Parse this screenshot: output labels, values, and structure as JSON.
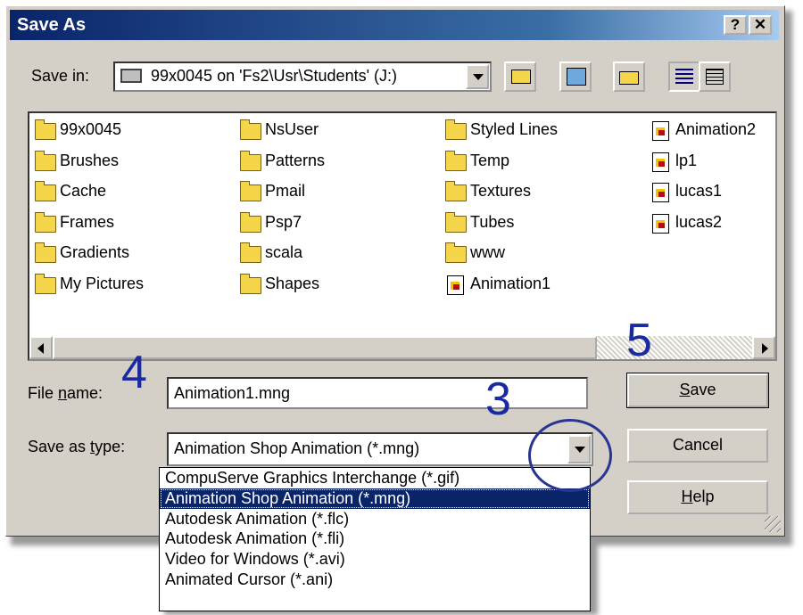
{
  "window": {
    "title": "Save As",
    "help_btn": "?",
    "close_btn": "✕"
  },
  "toolbar": {
    "save_in_label": "Save in:",
    "save_in_value": "99x0045 on 'Fs2\\Usr\\Students' (J:)",
    "tools": [
      "up-folder-icon",
      "desktop-icon",
      "new-folder-icon",
      "list-view-icon",
      "details-view-icon"
    ]
  },
  "files": {
    "columns": [
      [
        {
          "name": "99x0045",
          "type": "folder"
        },
        {
          "name": "Brushes",
          "type": "folder"
        },
        {
          "name": "Cache",
          "type": "folder"
        },
        {
          "name": "Frames",
          "type": "folder"
        },
        {
          "name": "Gradients",
          "type": "folder"
        },
        {
          "name": "My Pictures",
          "type": "folder"
        }
      ],
      [
        {
          "name": "NsUser",
          "type": "folder"
        },
        {
          "name": "Patterns",
          "type": "folder"
        },
        {
          "name": "Pmail",
          "type": "folder"
        },
        {
          "name": "Psp7",
          "type": "folder"
        },
        {
          "name": "scala",
          "type": "folder"
        },
        {
          "name": "Shapes",
          "type": "folder"
        }
      ],
      [
        {
          "name": "Styled Lines",
          "type": "folder"
        },
        {
          "name": "Temp",
          "type": "folder"
        },
        {
          "name": "Textures",
          "type": "folder"
        },
        {
          "name": "Tubes",
          "type": "folder"
        },
        {
          "name": "www",
          "type": "folder"
        },
        {
          "name": "Animation1",
          "type": "file"
        }
      ],
      [
        {
          "name": "Animation2",
          "type": "file"
        },
        {
          "name": "lp1",
          "type": "file"
        },
        {
          "name": "lucas1",
          "type": "file"
        },
        {
          "name": "lucas2",
          "type": "file"
        }
      ]
    ]
  },
  "form": {
    "file_name_label": "File name:",
    "file_name_value": "Animation1.mng",
    "save_type_label": "Save as type:",
    "save_type_value": "Animation Shop Animation (*.mng)"
  },
  "buttons": {
    "save": "Save",
    "cancel": "Cancel",
    "help": "Help"
  },
  "type_options": [
    "CompuServe Graphics Interchange (*.gif)",
    "Animation Shop Animation (*.mng)",
    "Autodesk Animation (*.flc)",
    "Autodesk Animation (*.fli)",
    "Video for Windows (*.avi)",
    "Animated Cursor (*.ani)"
  ],
  "selected_option_index": 1,
  "annotations": {
    "step3": "3",
    "step4": "4",
    "step5": "5"
  },
  "colors": {
    "titlebar": "#0a246a",
    "selection": "#0a246a",
    "annotation": "#1a2aa0"
  }
}
